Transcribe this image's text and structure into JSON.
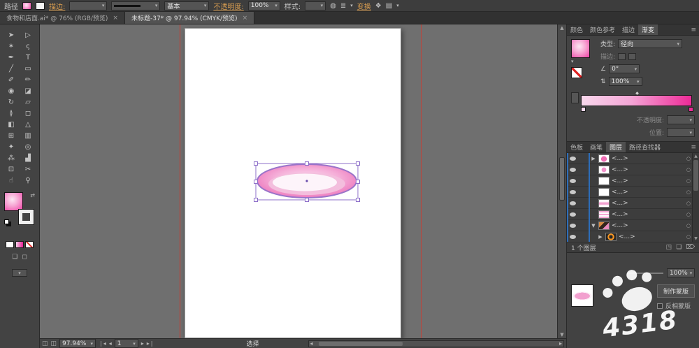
{
  "control_bar": {
    "object_label": "路径",
    "stroke_link": "描边:",
    "brush_value": "基本",
    "opacity_link": "不透明度:",
    "opacity_value": "100%",
    "style_label": "样式:",
    "transform_link": "变换"
  },
  "document_tabs": [
    {
      "label": "食物和店面.ai* @ 76% (RGB/预览)",
      "close": "×"
    },
    {
      "label": "未标题-37* @ 97.94% (CMYK/预览)",
      "close": "×"
    }
  ],
  "toolbar": {
    "tools": [
      {
        "name": "selection",
        "glyph": "➤"
      },
      {
        "name": "direct-selection",
        "glyph": "▷"
      },
      {
        "name": "magic-wand",
        "glyph": "✶"
      },
      {
        "name": "lasso",
        "glyph": "ς"
      },
      {
        "name": "pen",
        "glyph": "✒"
      },
      {
        "name": "type",
        "glyph": "T"
      },
      {
        "name": "line-segment",
        "glyph": "╱"
      },
      {
        "name": "rectangle",
        "glyph": "▭"
      },
      {
        "name": "paintbrush",
        "glyph": "✐"
      },
      {
        "name": "pencil",
        "glyph": "✏"
      },
      {
        "name": "blob-brush",
        "glyph": "◉"
      },
      {
        "name": "eraser",
        "glyph": "◪"
      },
      {
        "name": "rotate",
        "glyph": "↻"
      },
      {
        "name": "scale",
        "glyph": "▱"
      },
      {
        "name": "width",
        "glyph": "≬"
      },
      {
        "name": "free-transform",
        "glyph": "◻"
      },
      {
        "name": "shape-builder",
        "glyph": "◧"
      },
      {
        "name": "perspective-grid",
        "glyph": "△"
      },
      {
        "name": "mesh",
        "glyph": "⊞"
      },
      {
        "name": "gradient",
        "glyph": "▥"
      },
      {
        "name": "eyedropper",
        "glyph": "✦"
      },
      {
        "name": "blend",
        "glyph": "◎"
      },
      {
        "name": "symbol-sprayer",
        "glyph": "⁂"
      },
      {
        "name": "column-graph",
        "glyph": "▟"
      },
      {
        "name": "artboard",
        "glyph": "⊡"
      },
      {
        "name": "slice",
        "glyph": "✂"
      },
      {
        "name": "hand",
        "glyph": "☝"
      },
      {
        "name": "zoom",
        "glyph": "⚲"
      }
    ]
  },
  "gradient_panel": {
    "tabs": [
      "颜色",
      "颜色参考",
      "描边",
      "渐变"
    ],
    "type_label": "类型:",
    "type_value": "径向",
    "stroke_label": "描边:",
    "angle_symbol": "∠",
    "angle_value": "0°",
    "aspect_value": "100%",
    "opacity_label": "不透明度:",
    "position_label": "位置:"
  },
  "layers_panel": {
    "tabs": [
      "色板",
      "画笔",
      "图层",
      "路径查找器"
    ],
    "rows": [
      {
        "label": "<...>",
        "expand": "▶"
      },
      {
        "label": "<...>",
        "expand": ""
      },
      {
        "label": "<...>",
        "expand": ""
      },
      {
        "label": "<...>",
        "expand": ""
      },
      {
        "label": "<...>",
        "expand": ""
      },
      {
        "label": "<...>",
        "expand": ""
      },
      {
        "label": "<...>",
        "expand": "▼"
      },
      {
        "label": "<...>",
        "expand": "▶"
      }
    ],
    "footer_text": "1 个图层"
  },
  "transparency_panel": {
    "opacity_value": "100%",
    "make_mask_button": "制作蒙版",
    "invert_mask_label": "反相蒙版"
  },
  "status_bar": {
    "zoom_value": "97.94%",
    "page_value": "1",
    "status_text": "选择"
  },
  "watermark": {
    "text": "4318"
  },
  "icons": {
    "dropdown_arrow": "▾",
    "panel_menu": "≡",
    "swap": "⇄",
    "recolor": "◍",
    "align": "≣",
    "isolate": "❖",
    "styles": "▤",
    "angle": "∠",
    "aspect": "⇅",
    "midpoint": "◆",
    "target": "○",
    "nav_first": "❘◂",
    "nav_prev": "◂",
    "nav_next": "▸",
    "nav_last": "▸❘",
    "arrow_up": "▲",
    "arrow_down": "▼",
    "arrow_left": "◂",
    "arrow_right": "▸",
    "status_sq": "◫",
    "draw_normal": "❏",
    "draw_inside": "◻",
    "collect": "◳",
    "new_layer": "❏",
    "delete_layer": "⌦"
  },
  "colors": {
    "accent_pink": "#ee3fa4",
    "gradient_start": "#f8d7ec",
    "gradient_end": "#ee2a97",
    "selection_purple": "#8d6fc9",
    "guide_red": "#cf3b30",
    "link_orange": "#d79c50",
    "layer_highlight_blue": "#2d6db8"
  }
}
